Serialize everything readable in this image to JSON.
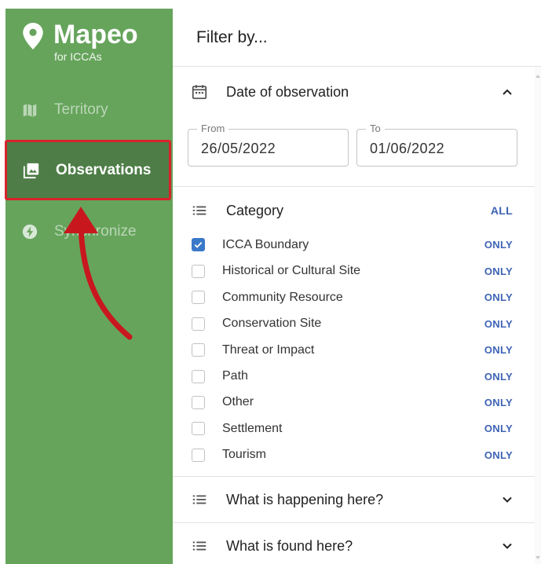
{
  "app": {
    "name": "Mapeo",
    "subtitle": "for ICCAs"
  },
  "sidebar": {
    "items": [
      {
        "label": "Territory",
        "icon": "map-icon",
        "active": false
      },
      {
        "label": "Observations",
        "icon": "photo-library-icon",
        "active": true
      },
      {
        "label": "Synchronize",
        "icon": "bolt-icon",
        "active": false
      }
    ]
  },
  "panel": {
    "title": "Filter by...",
    "date": {
      "title": "Date of observation",
      "from_label": "From",
      "from_value": "26/05/2022",
      "to_label": "To",
      "to_value": "01/06/2022"
    },
    "category": {
      "title": "Category",
      "all_label": "ALL",
      "only_label": "ONLY",
      "items": [
        {
          "label": "ICCA Boundary",
          "checked": true
        },
        {
          "label": "Historical or Cultural Site",
          "checked": false
        },
        {
          "label": "Community Resource",
          "checked": false
        },
        {
          "label": "Conservation Site",
          "checked": false
        },
        {
          "label": "Threat or Impact",
          "checked": false
        },
        {
          "label": "Path",
          "checked": false
        },
        {
          "label": "Other",
          "checked": false
        },
        {
          "label": "Settlement",
          "checked": false
        },
        {
          "label": "Tourism",
          "checked": false
        }
      ]
    },
    "happening": {
      "title": "What is happening here?"
    },
    "found": {
      "title": "What is found here?"
    }
  },
  "colors": {
    "sidebar_bg": "#66a45c",
    "active_bg": "#4e7d47",
    "highlight_border": "#d8232a",
    "link_blue": "#3e63b5",
    "checkbox_blue": "#3a78c9"
  }
}
